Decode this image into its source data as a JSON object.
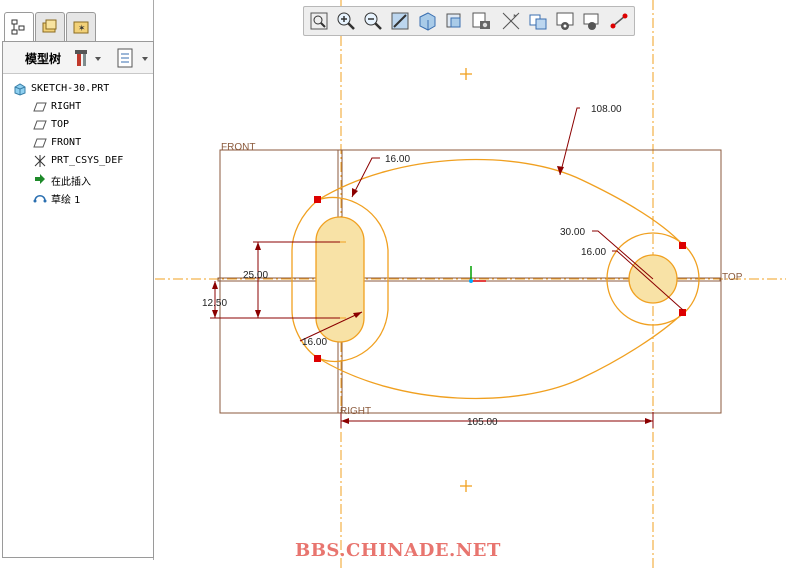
{
  "model_tree": {
    "title": "模型树",
    "items": [
      {
        "label": "SKETCH-30.PRT",
        "icon": "part-icon"
      },
      {
        "label": "RIGHT",
        "icon": "datum-plane-icon"
      },
      {
        "label": "TOP",
        "icon": "datum-plane-icon"
      },
      {
        "label": "FRONT",
        "icon": "datum-plane-icon"
      },
      {
        "label": "PRT_CSYS_DEF",
        "icon": "csys-icon"
      },
      {
        "label": "在此插入",
        "icon": "insert-here-arrow-icon"
      },
      {
        "label": "草绘 1",
        "icon": "sketch-icon"
      }
    ]
  },
  "toolbar": {
    "buttons": [
      "refit-icon",
      "zoom-in-icon",
      "zoom-out-icon",
      "repaint-icon",
      "saved-views-icon",
      "display-style-icon",
      "view-manager-icon",
      "datum-display-icon",
      "sketch-view-icon",
      "sketch-display-icon",
      "constraint-display-icon",
      "vertex-display-icon"
    ]
  },
  "sketch": {
    "plane_labels": {
      "front": "FRONT",
      "top": "TOP",
      "right": "RIGHT"
    },
    "dimensions": {
      "overall_radius": "108.00",
      "slot_radius_top": "16.00",
      "slot_radius_bottom": "16.00",
      "slot_height": "25.00",
      "slot_offset": "12.50",
      "right_radius_outer": "30.00",
      "right_radius_inner": "16.00",
      "center_distance": "105.00"
    }
  },
  "watermark": "BBS.CHINADE.NET",
  "colors": {
    "sketch_orange": "#f0a020",
    "dimension": "#8b0000",
    "datum_plane": "#8b5a3c",
    "centerline": "#f0a020",
    "fill": "#f8e2a6",
    "constraint_marker": "#dd0000"
  }
}
